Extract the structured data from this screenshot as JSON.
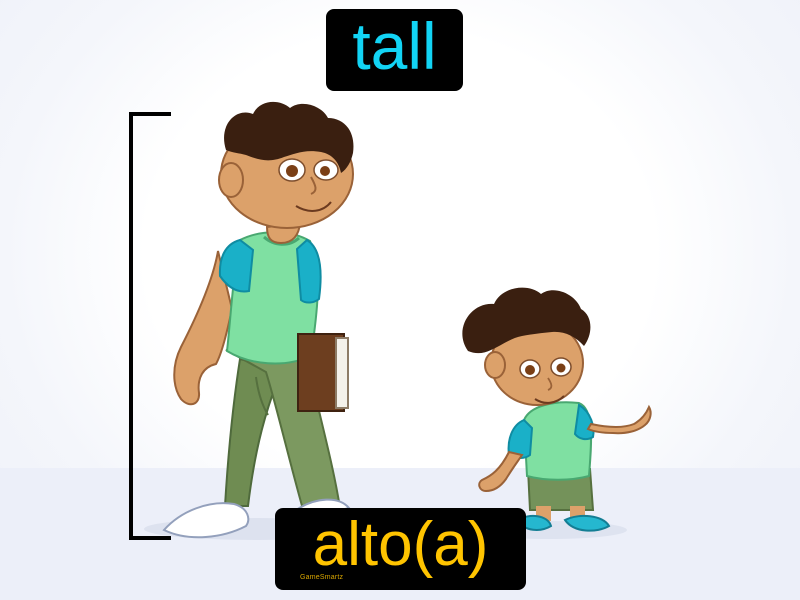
{
  "card": {
    "english_word": "tall",
    "spanish_word": "alto(a)",
    "brand": "GameSmartz"
  },
  "colors": {
    "english_text": "#12d4f5",
    "spanish_text": "#ffc400",
    "label_background": "#000000",
    "skin": "#dca16a",
    "hair": "#3a1f10",
    "shirt": "#7fe0a2",
    "sleeves": "#1ab0c8",
    "pants": "#74925a",
    "book": "#6d3e1f",
    "shoes_child": "#25b7cf"
  }
}
